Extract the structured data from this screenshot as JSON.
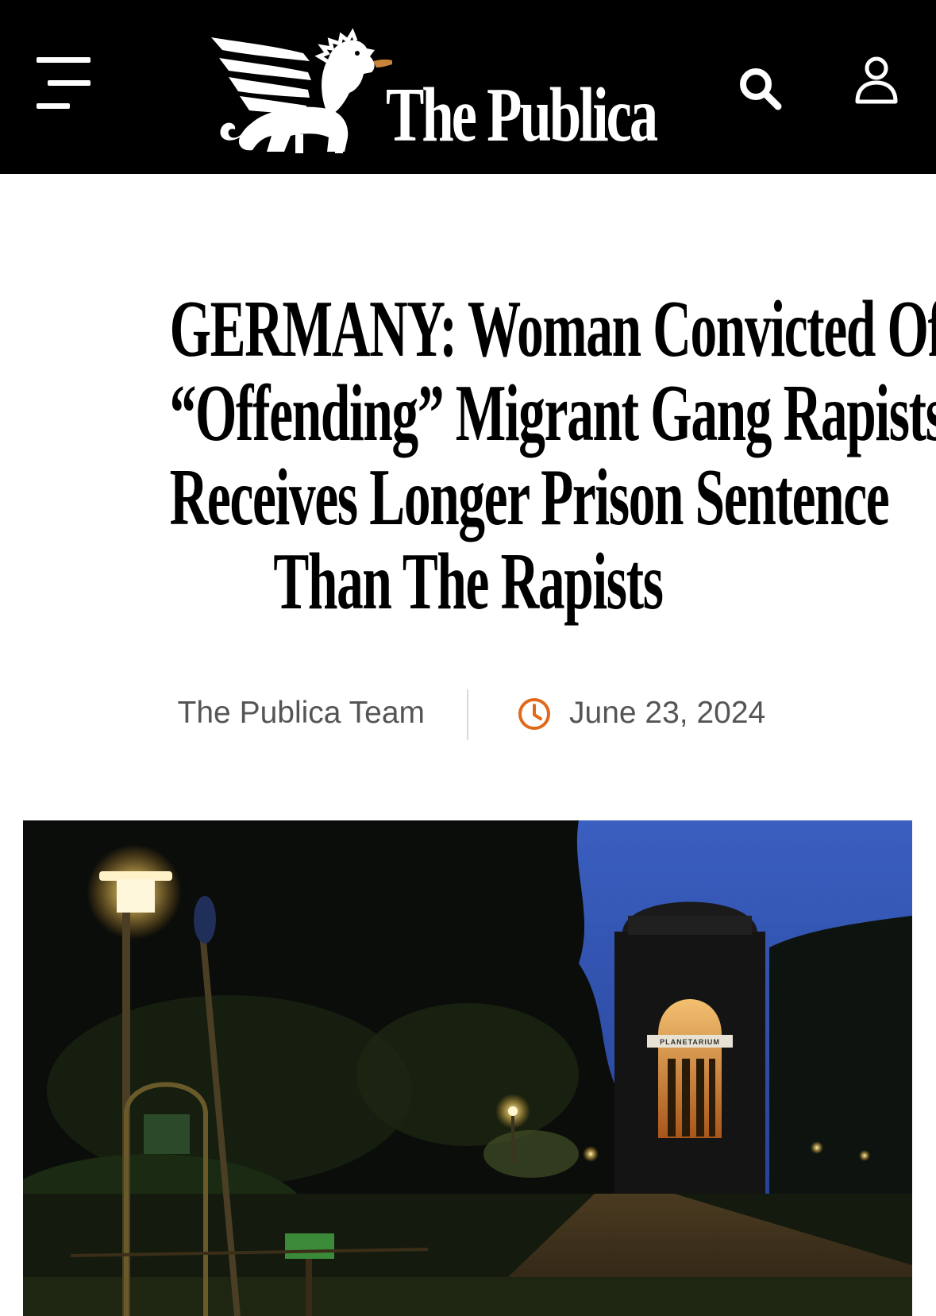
{
  "site": {
    "name": "The Publica"
  },
  "header": {
    "menu_icon": "hamburger-menu-icon",
    "search_icon": "search-icon",
    "account_icon": "user-icon"
  },
  "article": {
    "headline_lines": [
      "GERMANY: Woman Convicted Of",
      "“Offending” Migrant Gang Rapists",
      "Receives Longer Prison Sentence",
      "Than The Rapists"
    ],
    "author": "The Publica Team",
    "date": "June 23, 2024",
    "date_icon": "clock-icon",
    "accent_color": "#e06a1b"
  },
  "hero_image": {
    "sign_text": "PLANETARIUM"
  }
}
